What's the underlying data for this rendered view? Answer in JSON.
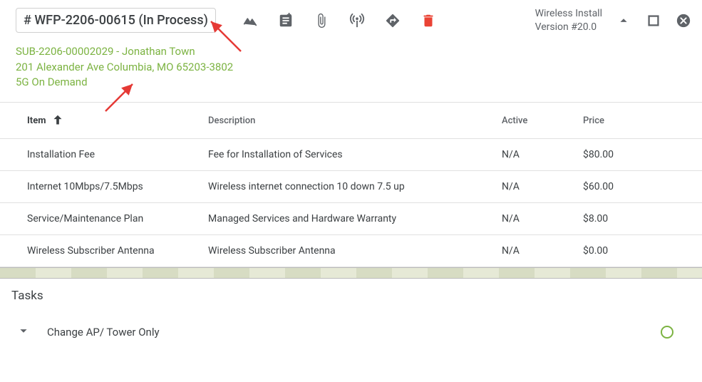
{
  "header": {
    "title": "# WFP-2206-00615 (In Process)",
    "version_line1": "Wireless Install",
    "version_line2": "Version #20.0"
  },
  "subscriber": {
    "line1": "SUB-2206-00002029 - Jonathan Town",
    "line2": "201 Alexander Ave Columbia, MO 65203-3802",
    "line3": "5G On Demand"
  },
  "columns": {
    "item": "Item",
    "description": "Description",
    "active": "Active",
    "price": "Price"
  },
  "rows": [
    {
      "item": "Installation Fee",
      "desc": "Fee for Installation of Services",
      "active": "N/A",
      "price": "$80.00"
    },
    {
      "item": "Internet 10Mbps/7.5Mbps",
      "desc": "Wireless internet connection 10 down 7.5 up",
      "active": "N/A",
      "price": "$60.00"
    },
    {
      "item": "Service/Maintenance Plan",
      "desc": "Managed Services and Hardware Warranty",
      "active": "N/A",
      "price": "$8.00"
    },
    {
      "item": "Wireless Subscriber Antenna",
      "desc": "Wireless Subscriber Antenna",
      "active": "N/A",
      "price": "$0.00"
    }
  ],
  "tasks": {
    "heading": "Tasks",
    "items": [
      {
        "name": "Change AP/ Tower Only"
      }
    ]
  }
}
